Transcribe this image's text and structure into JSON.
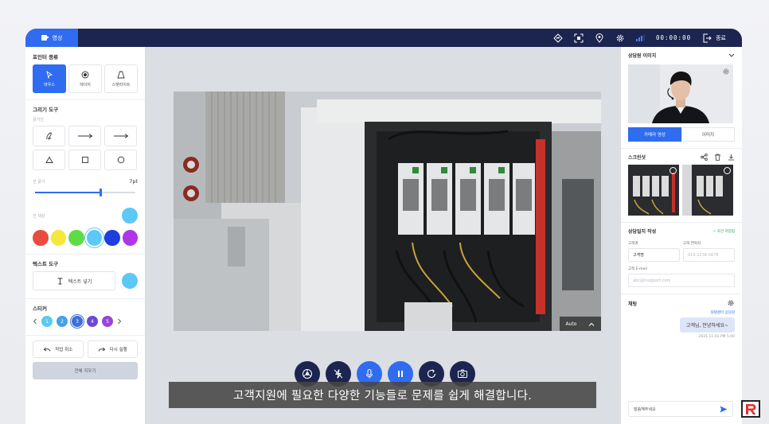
{
  "topbar": {
    "video_tab": "영상",
    "timer": "00:00:00",
    "end_label": "종료"
  },
  "left": {
    "pointer_title": "포인터 종류",
    "pointers": [
      "마우스",
      "레이저",
      "스펫라이트"
    ],
    "draw_title": "그리기 도구",
    "line_label": "굵기선",
    "thickness_label": "선 굵기",
    "thickness_value": "7pt",
    "thickness_fraction": 0.65,
    "color_label": "선 색상",
    "palette": [
      "#e94b3c",
      "#f5e83a",
      "#5fdb45",
      "#5cc8f6",
      "#1d3fe0",
      "#b035e8"
    ],
    "text_title": "텍스트 도구",
    "text_button": "텍스트 넣기",
    "sticker_title": "스티커",
    "stickers": [
      "1",
      "2",
      "3",
      "4",
      "5"
    ],
    "undo": "작업 취소",
    "redo": "다시 실행",
    "clear": "전체 지우기"
  },
  "center": {
    "auto": "Auto",
    "caption": "고객지원에 필요한 다양한 기능들로 문제를 쉽게 해결합니다."
  },
  "right": {
    "agent_title": "상담원 이미지",
    "camera_tab": "카메라 영상",
    "image_tab": "이미지",
    "screenshot_title": "스크린샷",
    "log_title": "상담일지 작성",
    "saved": "✓ 초안 저장됨",
    "name_label": "고객명",
    "name_value": "고객명",
    "phone_label": "고객 연락처",
    "phone_placeholder": "010-1234-5678",
    "email_label": "고객 E-mail",
    "email_placeholder": "abc@rsupport.com",
    "chat_title": "채팅",
    "chat_sender": "원탭센터 상담원",
    "chat_message": "고객님, 안녕하세요~",
    "chat_time": "2021.11.03 PM 5:00",
    "chat_placeholder": "말씀해주세요"
  },
  "colors": {
    "accent": "#2f6cf0",
    "navy": "#1c2550"
  }
}
